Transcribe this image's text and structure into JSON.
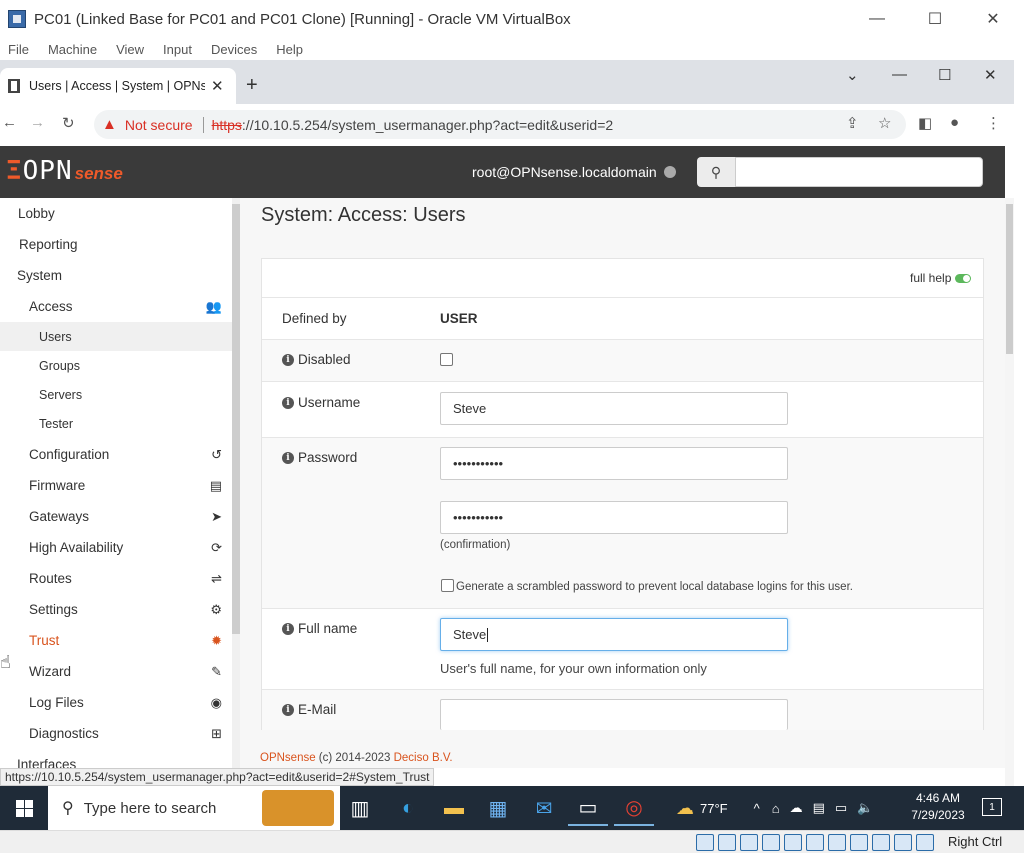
{
  "vbox": {
    "title": "PC01 (Linked Base for PC01 and PC01 Clone) [Running] - Oracle VM VirtualBox",
    "menu": [
      "File",
      "Machine",
      "View",
      "Input",
      "Devices",
      "Help"
    ],
    "host_key": "Right Ctrl"
  },
  "browser": {
    "tab_title": "Users | Access | System | OPNsense",
    "not_secure": "Not secure",
    "url_scheme": "https",
    "url_rest": "://10.10.5.254/system_usermanager.php?act=edit&userid=2",
    "status_url": "https://10.10.5.254/system_usermanager.php?act=edit&userid=2#System_Trust"
  },
  "opnsense": {
    "logo_a": "OPN",
    "logo_b": "sense",
    "user": "root@OPNsense.localdomain",
    "search_placeholder": ""
  },
  "sidebar": {
    "lobby": "Lobby",
    "reporting": "Reporting",
    "system": "System",
    "access": "Access",
    "users": "Users",
    "groups": "Groups",
    "servers": "Servers",
    "tester": "Tester",
    "configuration": "Configuration",
    "firmware": "Firmware",
    "gateways": "Gateways",
    "high_availability": "High Availability",
    "routes": "Routes",
    "settings": "Settings",
    "trust": "Trust",
    "wizard": "Wizard",
    "log_files": "Log Files",
    "diagnostics": "Diagnostics",
    "interfaces": "Interfaces"
  },
  "main": {
    "page_title": "System: Access: Users",
    "full_help": "full help",
    "defined_by_label": "Defined by",
    "defined_by_value": "USER",
    "disabled_label": "Disabled",
    "username_label": "Username",
    "username_value": "Steve",
    "password_label": "Password",
    "password_value": "•••••••••••",
    "password_confirm_value": "•••••••••••",
    "confirmation_hint": "(confirmation)",
    "scramble_label": "Generate a scrambled password to prevent local database logins for this user.",
    "fullname_label": "Full name",
    "fullname_value": "Steve",
    "fullname_hint": "User's full name, for your own information only",
    "email_label": "E-Mail",
    "email_value": ""
  },
  "footer": {
    "brand": "OPNsense",
    "copy": " (c) 2014-2023 ",
    "company": "Deciso B.V."
  },
  "taskbar": {
    "search_placeholder": "Type here to search",
    "weather": "77°F",
    "time": "4:46 AM",
    "date": "7/29/2023",
    "notifications": "1"
  }
}
